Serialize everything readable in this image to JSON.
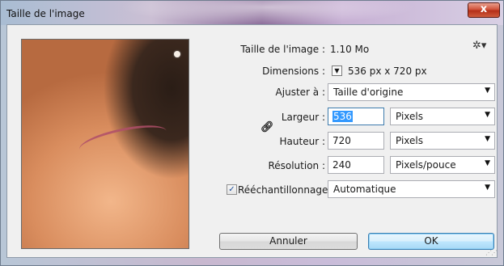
{
  "window": {
    "title": "Taille de l'image",
    "close_glyph": "x"
  },
  "info": {
    "image_size_label": "Taille de l'image :",
    "image_size_value": "1.10 Mo",
    "dimensions_label": "Dimensions :",
    "dimensions_value": "536 px  x  720 px"
  },
  "fit": {
    "label": "Ajuster à :",
    "value": "Taille d'origine"
  },
  "width": {
    "label": "Largeur :",
    "value": "536",
    "unit": "Pixels"
  },
  "height": {
    "label": "Hauteur :",
    "value": "720",
    "unit": "Pixels"
  },
  "resolution": {
    "label": "Résolution :",
    "value": "240",
    "unit": "Pixels/pouce"
  },
  "resample": {
    "label": "Rééchantillonnage :",
    "checked": true,
    "value": "Automatique"
  },
  "buttons": {
    "cancel": "Annuler",
    "ok": "OK"
  },
  "icons": {
    "gear": "gear-icon",
    "link": "link-icon",
    "dropdown": "chevron-down-icon"
  },
  "colors": {
    "selection": "#3399ff",
    "default_button": "#bee6fd",
    "close_button": "#c9462c"
  }
}
